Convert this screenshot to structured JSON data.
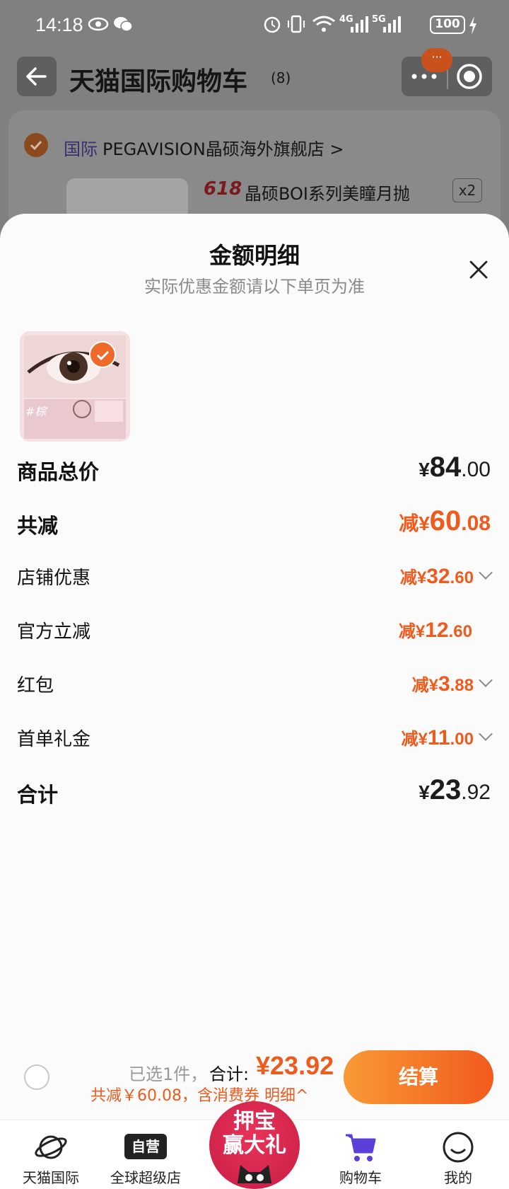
{
  "status_bar": {
    "time": "14:18",
    "network_4g": "4G",
    "network_5g": "5G",
    "battery": "100"
  },
  "header": {
    "title": "天猫国际购物车",
    "count": "(8)",
    "more_badge": "···"
  },
  "store": {
    "tag": "国际",
    "name": "PEGAVISION晶硕海外旗舰店 >"
  },
  "product": {
    "promo_tag": "618",
    "title": "晶硕BOI系列美瞳月抛",
    "quantity": "x2"
  },
  "sheet": {
    "title": "金额明细",
    "subtitle": "实际优惠金额请以下单页为准",
    "thumb_color_label": "#棕",
    "rows": [
      {
        "label": "商品总价",
        "prefix": "",
        "currency": "¥",
        "int": "84",
        "dec": ".00",
        "chevron": false
      },
      {
        "label": "共减",
        "prefix": "减",
        "currency": "¥",
        "int": "60",
        "dec": ".08",
        "chevron": false
      },
      {
        "label": "店铺优惠",
        "prefix": "减",
        "currency": "¥",
        "int": "32",
        "dec": ".60",
        "chevron": true
      },
      {
        "label": "官方立减",
        "prefix": "减",
        "currency": "¥",
        "int": "12",
        "dec": ".60",
        "chevron": false
      },
      {
        "label": "红包",
        "prefix": "减",
        "currency": "¥",
        "int": "3",
        "dec": ".88",
        "chevron": true
      },
      {
        "label": "首单礼金",
        "prefix": "减",
        "currency": "¥",
        "int": "11",
        "dec": ".00",
        "chevron": true
      },
      {
        "label": "合计",
        "prefix": "",
        "currency": "¥",
        "int": "23",
        "dec": ".92",
        "chevron": false
      }
    ]
  },
  "bottom_bar": {
    "selected": "已选1件，",
    "total_label": "合计:",
    "total_value": "¥23.92",
    "detail": "共减￥60.08，含消费券  明细^",
    "checkout": "结算"
  },
  "promo_badge": {
    "line1": "押宝",
    "line2": "赢大礼"
  },
  "tabs": [
    {
      "label": "天猫国际"
    },
    {
      "label": "全球超级店",
      "icon_text": "自营"
    },
    {
      "label": "购物车"
    },
    {
      "label": "我的"
    }
  ],
  "colors": {
    "accent": "#ef5a1d",
    "checkout_start": "#f89a36",
    "checkout_end": "#f25a1d",
    "tab_active": "#5b3fd9"
  }
}
